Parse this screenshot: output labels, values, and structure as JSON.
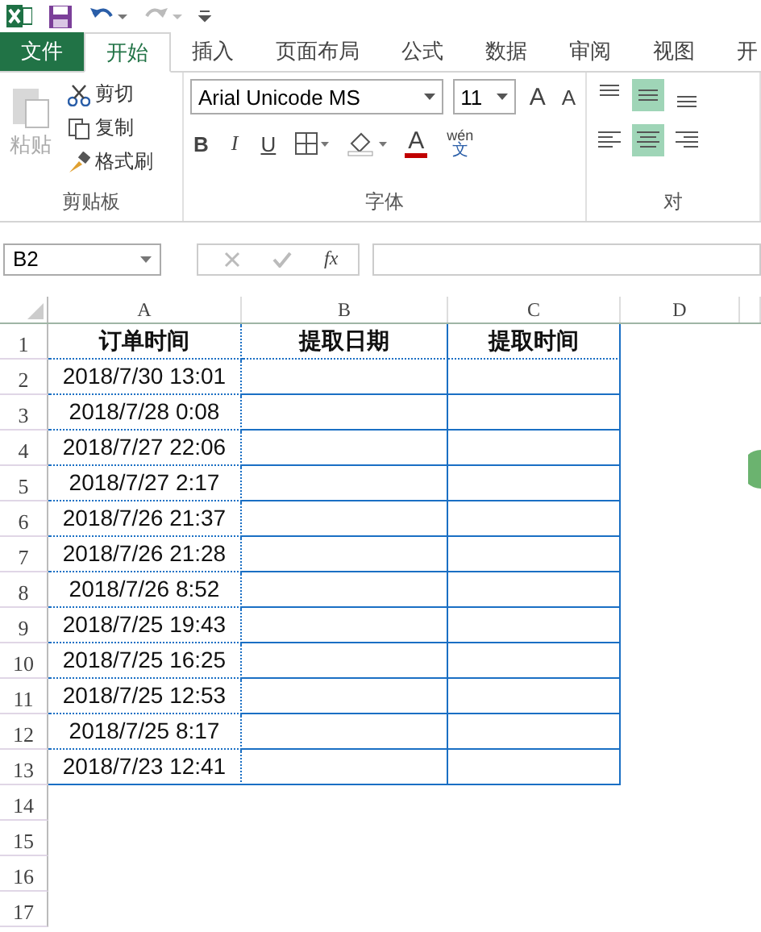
{
  "quick_access": [
    {
      "kind": "undo",
      "disabled": false
    },
    {
      "kind": "redo",
      "disabled": true
    }
  ],
  "tabs": [
    {
      "label": "文件",
      "kind": "file",
      "selected": false
    },
    {
      "label": "开始",
      "kind": "tab",
      "selected": true
    },
    {
      "label": "插入",
      "kind": "tab",
      "selected": false
    },
    {
      "label": "页面布局",
      "kind": "tab",
      "selected": false
    },
    {
      "label": "公式",
      "kind": "tab",
      "selected": false
    },
    {
      "label": "数据",
      "kind": "tab",
      "selected": false
    },
    {
      "label": "审阅",
      "kind": "tab",
      "selected": false
    },
    {
      "label": "视图",
      "kind": "tab",
      "selected": false
    },
    {
      "label": "开",
      "kind": "tab",
      "selected": false
    }
  ],
  "ribbon": {
    "clipboard": {
      "paste": {
        "label": "粘贴",
        "disabled": true
      },
      "items": [
        {
          "kind": "cut",
          "label": "剪切"
        },
        {
          "kind": "copy",
          "label": "复制"
        },
        {
          "kind": "painter",
          "label": "格式刷"
        }
      ],
      "group_label": "剪贴板"
    },
    "font": {
      "font_name": "Arial Unicode MS",
      "font_size": "11",
      "grow": "A",
      "shrink": "A",
      "styles": [
        "B",
        "I",
        "U"
      ],
      "font_color": "A",
      "phonetic": {
        "top": "wén",
        "bottom": "文"
      },
      "group_label": "字体"
    },
    "alignment": {
      "top_row": [
        {
          "kind": "top",
          "selected": false
        },
        {
          "kind": "middle",
          "selected": true
        },
        {
          "kind": "bottom",
          "selected": false
        }
      ],
      "bottom_row": [
        {
          "kind": "left",
          "selected": false
        },
        {
          "kind": "center",
          "selected": true
        },
        {
          "kind": "right",
          "selected": false
        }
      ],
      "group_label": "对"
    }
  },
  "formula_bar": {
    "name_box": "B2",
    "function_label": "fx"
  },
  "sheet": {
    "columns": [
      "A",
      "B",
      "C",
      "D"
    ],
    "rows": [
      {
        "number": "1",
        "kind": "header",
        "cells": [
          "订单时间",
          "提取日期",
          "提取时间"
        ]
      },
      {
        "number": "2",
        "kind": "data",
        "cells": [
          "2018/7/30 13:01"
        ]
      },
      {
        "number": "3",
        "kind": "data",
        "cells": [
          "2018/7/28 0:08"
        ]
      },
      {
        "number": "4",
        "kind": "data",
        "cells": [
          "2018/7/27 22:06"
        ]
      },
      {
        "number": "5",
        "kind": "data",
        "cells": [
          "2018/7/27 2:17"
        ]
      },
      {
        "number": "6",
        "kind": "data",
        "cells": [
          "2018/7/26 21:37"
        ]
      },
      {
        "number": "7",
        "kind": "data",
        "cells": [
          "2018/7/26 21:28"
        ]
      },
      {
        "number": "8",
        "kind": "data",
        "cells": [
          "2018/7/26 8:52"
        ]
      },
      {
        "number": "9",
        "kind": "data",
        "cells": [
          "2018/7/25 19:43"
        ]
      },
      {
        "number": "10",
        "kind": "data",
        "cells": [
          "2018/7/25 16:25"
        ]
      },
      {
        "number": "11",
        "kind": "data",
        "cells": [
          "2018/7/25 12:53"
        ]
      },
      {
        "number": "12",
        "kind": "data",
        "cells": [
          "2018/7/25 8:17"
        ]
      },
      {
        "number": "13",
        "kind": "data",
        "cells": [
          "2018/7/23 12:41"
        ]
      },
      {
        "number": "14",
        "kind": "empty",
        "cells": []
      },
      {
        "number": "15",
        "kind": "empty",
        "cells": []
      },
      {
        "number": "16",
        "kind": "empty",
        "cells": []
      },
      {
        "number": "17",
        "kind": "empty",
        "cells": []
      }
    ]
  }
}
